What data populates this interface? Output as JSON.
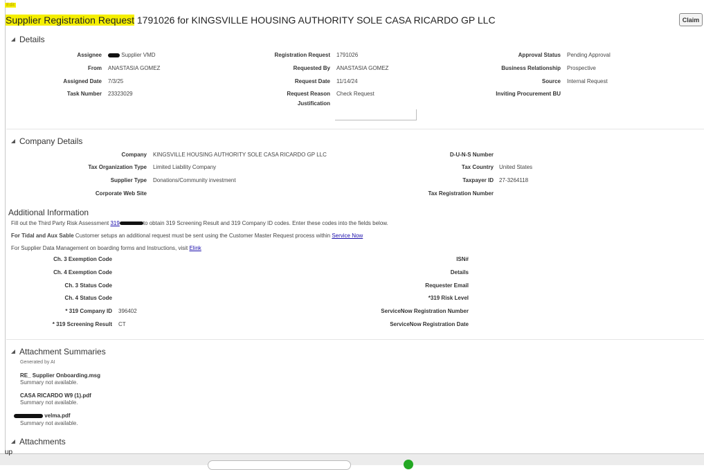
{
  "edit_label": "Edit",
  "title": {
    "highlighted": "Supplier Registration Request",
    "rest": " 1791026 for KINGSVILLE HOUSING AUTHORITY SOLE CASA RICARDO GP LLC"
  },
  "claim_label": "Claim",
  "sections": {
    "details": "Details",
    "company_details": "Company Details",
    "additional_info": "Additional Information",
    "attachment_summaries": "Attachment Summaries",
    "attachments": "Attachments"
  },
  "details": {
    "assignee_label": "Assignee",
    "assignee_value": "Supplier VMD",
    "from_label": "From",
    "from_value": "ANASTASIA GOMEZ",
    "assigned_date_label": "Assigned Date",
    "assigned_date_value": "7/3/25",
    "task_number_label": "Task Number",
    "task_number_value": "23323029",
    "registration_request_label": "Registration Request",
    "registration_request_value": "1791026",
    "requested_by_label": "Requested By",
    "requested_by_value": "ANASTASIA GOMEZ",
    "request_date_label": "Request Date",
    "request_date_value": "11/14/24",
    "request_reason_label": "Request Reason",
    "request_reason_value": "Check Request",
    "justification_label": "Justification",
    "approval_status_label": "Approval Status",
    "approval_status_value": "Pending Approval",
    "business_relationship_label": "Business Relationship",
    "business_relationship_value": "Prospective",
    "source_label": "Source",
    "source_value": "Internal Request",
    "inviting_bu_label": "Inviting Procurement BU"
  },
  "company": {
    "company_label": "Company",
    "company_value": "KINGSVILLE HOUSING AUTHORITY SOLE CASA RICARDO GP LLC",
    "tax_org_type_label": "Tax Organization Type",
    "tax_org_type_value": "Limited Liability Company",
    "supplier_type_label": "Supplier Type",
    "supplier_type_value": "Donations/Community investment",
    "website_label": "Corporate Web Site",
    "duns_label": "D-U-N-S Number",
    "tax_country_label": "Tax Country",
    "tax_country_value": "United States",
    "taxpayer_id_label": "Taxpayer ID",
    "taxpayer_id_value": "27-3264118",
    "tax_reg_number_label": "Tax Registration Number"
  },
  "additional": {
    "line1_pre": "Fill out the Third Party Risk Assessment ",
    "line1_link": "319",
    "line1_post": "to obtain 319 Screening Result and 319 Company ID codes. Enter these codes into the fields below.",
    "line2_bold": "For Tidal and Aux Sable",
    "line2_text": " Customer setups an additional request must be sent using the Customer Master Request process within ",
    "line2_link": "Service Now",
    "line3_text": "For Supplier Data Management on boarding forms and Instructions, visit ",
    "line3_link": "Elink",
    "ch3_exemption_label": "Ch. 3 Exemption Code",
    "ch4_exemption_label": "Ch. 4 Exemption Code",
    "ch3_status_label": "Ch. 3 Status Code",
    "ch4_status_label": "Ch. 4 Status Code",
    "company_id_label": "* 319 Company ID",
    "company_id_value": "396402",
    "screening_result_label": "* 319 Screening Result",
    "screening_result_value": "CT",
    "isn_label": "ISN#",
    "details_label": "Details",
    "requester_email_label": "Requester Email",
    "risk_level_label": "*319 Risk Level",
    "sn_reg_number_label": "ServiceNow Registration Number",
    "sn_reg_date_label": "ServiceNow Registration Date"
  },
  "attachment_summaries": {
    "generated_by": "Generated by AI",
    "items": [
      {
        "name": "RE_ Supplier Onboarding.msg",
        "summary": "Summary not available."
      },
      {
        "name": "CASA RICARDO W9 (1).pdf",
        "summary": "Summary not available."
      },
      {
        "name": "velma.pdf",
        "summary": "Summary not available."
      }
    ]
  },
  "bottom_text": "up"
}
